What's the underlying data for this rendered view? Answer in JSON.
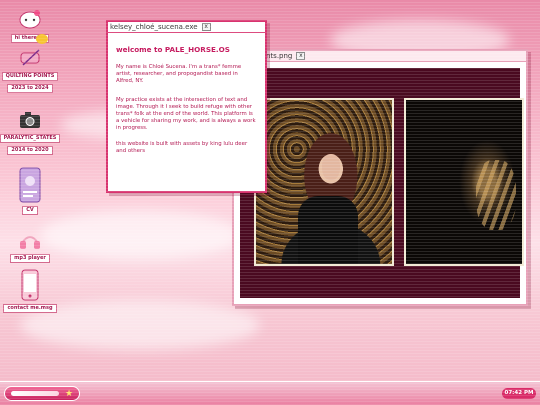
{
  "desktop": {
    "icons": [
      {
        "label": "hi there! (:",
        "icon": "hello-kitty-icon"
      },
      {
        "label": "QUILTING POINTS\n2023 to 2024",
        "label_line1": "QUILTING POINTS",
        "label_line2": "2023 to 2024",
        "icon": "sewing-icon"
      },
      {
        "label_line1": "PARALYTIC_STATES",
        "label_line2": "2014 to 2020",
        "icon": "camera-icon"
      },
      {
        "label": "CV",
        "icon": "cv-card-icon"
      },
      {
        "label": "mp3 player",
        "icon": "headphones-icon"
      },
      {
        "label": "contact me.msg",
        "icon": "phone-icon"
      }
    ]
  },
  "about_window": {
    "title": "kelsey_chloé_sucena.exe",
    "close": "x",
    "heading": "welcome to PALE_HORSE.OS",
    "p1": "My name is Chloé Sucena. I'm a trans* femme artist, researcher, and propogandist based in Alfred, NY.",
    "p2": "My practice exists at the intersection of text and image. Through it I seek to build refuge with other trans* folk at the end of the world. This platform is a vehicle for sharing my work, and is always a work in progress.",
    "p3": "this website is built with assets by king lulu deer and others"
  },
  "photo_window": {
    "title_visible": "nts.png",
    "close": "x"
  },
  "taskbar": {
    "time": "07:42 PM"
  },
  "colors": {
    "accent": "#d8336f",
    "text": "#b0104c",
    "stage": "#4a0a20"
  }
}
